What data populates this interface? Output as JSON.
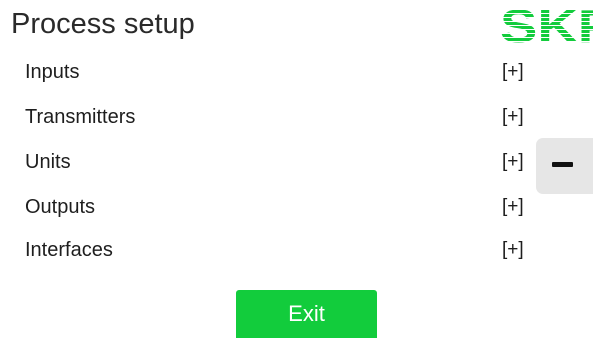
{
  "header": {
    "title": "Process setup",
    "logo_text": "SKF",
    "logo_color": "#12cc3c"
  },
  "menu": {
    "items": [
      {
        "label": "Inputs",
        "expander": "[+]"
      },
      {
        "label": "Transmitters",
        "expander": "[+]"
      },
      {
        "label": "Units",
        "expander": "[+]"
      },
      {
        "label": "Outputs",
        "expander": "[+]"
      },
      {
        "label": "Interfaces",
        "expander": "[+]"
      }
    ]
  },
  "side_tab": {
    "icon": "minus-icon"
  },
  "footer": {
    "exit_label": "Exit",
    "exit_color": "#12cc3c"
  }
}
